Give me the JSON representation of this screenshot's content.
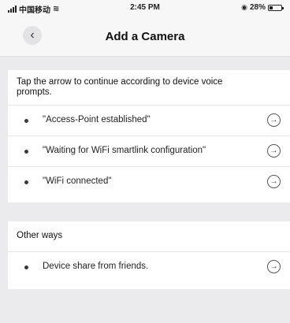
{
  "status_bar": {
    "carrier": "中国移动",
    "wifi_icon": "wifi-icon",
    "time": "2:45 PM",
    "battery_percent": "28%",
    "battery_level": 0.28
  },
  "nav": {
    "back_icon": "chevron-left-icon",
    "title": "Add a Camera"
  },
  "main": {
    "instruction": "Tap the arrow to continue according to device voice prompts.",
    "prompts": [
      {
        "label": "\"Access-Point established\""
      },
      {
        "label": "\"Waiting for WiFi smartlink configuration\""
      },
      {
        "label": "\"WiFi connected\""
      }
    ]
  },
  "other": {
    "title": "Other ways",
    "items": [
      {
        "label": "Device share from friends."
      }
    ]
  },
  "colors": {
    "background": "#ebebee",
    "card": "#ffffff",
    "text": "#1c1c1e"
  }
}
